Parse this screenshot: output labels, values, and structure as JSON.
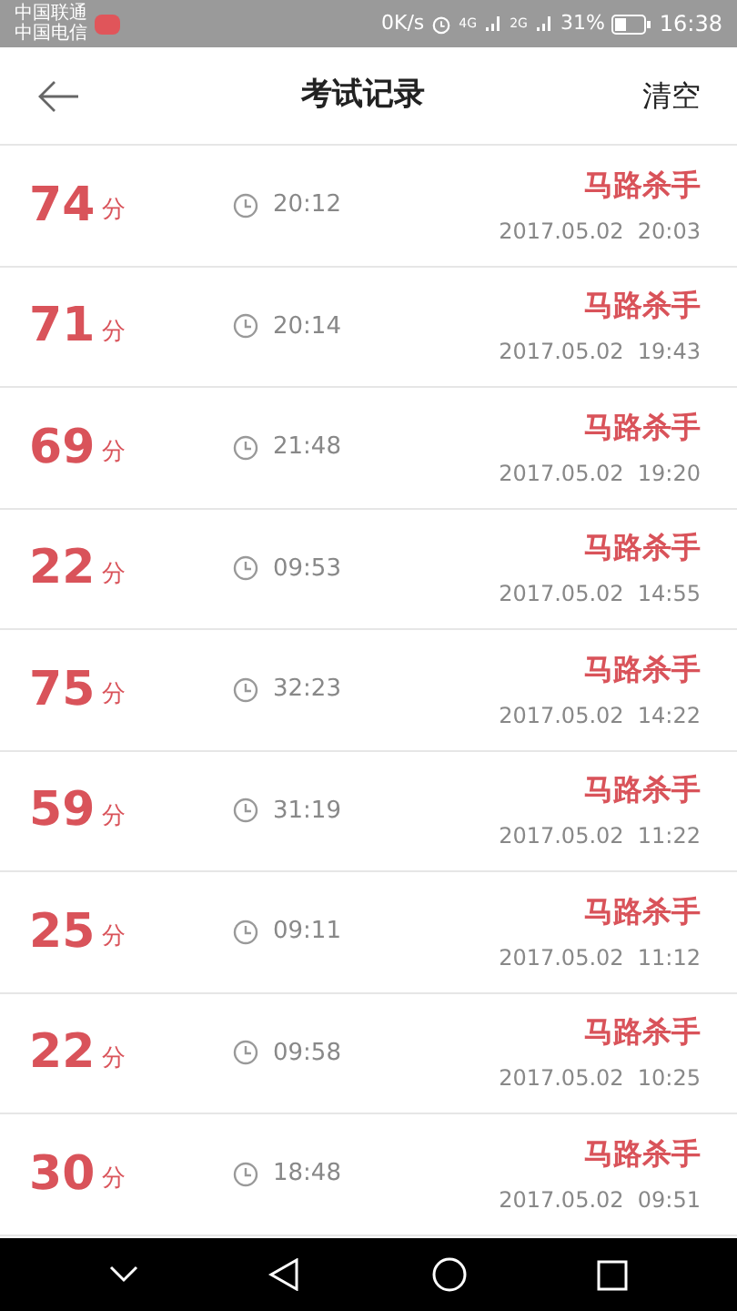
{
  "status_bar": {
    "carriers": [
      "中国联通",
      "中国电信"
    ],
    "speed": "0K/s",
    "network_1": "4G",
    "network_2": "2G",
    "battery": "31%",
    "time": "16:38"
  },
  "header": {
    "title": "考试记录",
    "action": "清空"
  },
  "records": [
    {
      "score": "74",
      "unit": "分",
      "duration": "20:12",
      "name": "马路杀手",
      "date": "2017.05.02  20:03"
    },
    {
      "score": "71",
      "unit": "分",
      "duration": "20:14",
      "name": "马路杀手",
      "date": "2017.05.02  19:43"
    },
    {
      "score": "69",
      "unit": "分",
      "duration": "21:48",
      "name": "马路杀手",
      "date": "2017.05.02  19:20"
    },
    {
      "score": "22",
      "unit": "分",
      "duration": "09:53",
      "name": "马路杀手",
      "date": "2017.05.02  14:55"
    },
    {
      "score": "75",
      "unit": "分",
      "duration": "32:23",
      "name": "马路杀手",
      "date": "2017.05.02  14:22"
    },
    {
      "score": "59",
      "unit": "分",
      "duration": "31:19",
      "name": "马路杀手",
      "date": "2017.05.02  11:22"
    },
    {
      "score": "25",
      "unit": "分",
      "duration": "09:11",
      "name": "马路杀手",
      "date": "2017.05.02  11:12"
    },
    {
      "score": "22",
      "unit": "分",
      "duration": "09:58",
      "name": "马路杀手",
      "date": "2017.05.02  10:25"
    },
    {
      "score": "30",
      "unit": "分",
      "duration": "18:48",
      "name": "马路杀手",
      "date": "2017.05.02  09:51"
    }
  ]
}
